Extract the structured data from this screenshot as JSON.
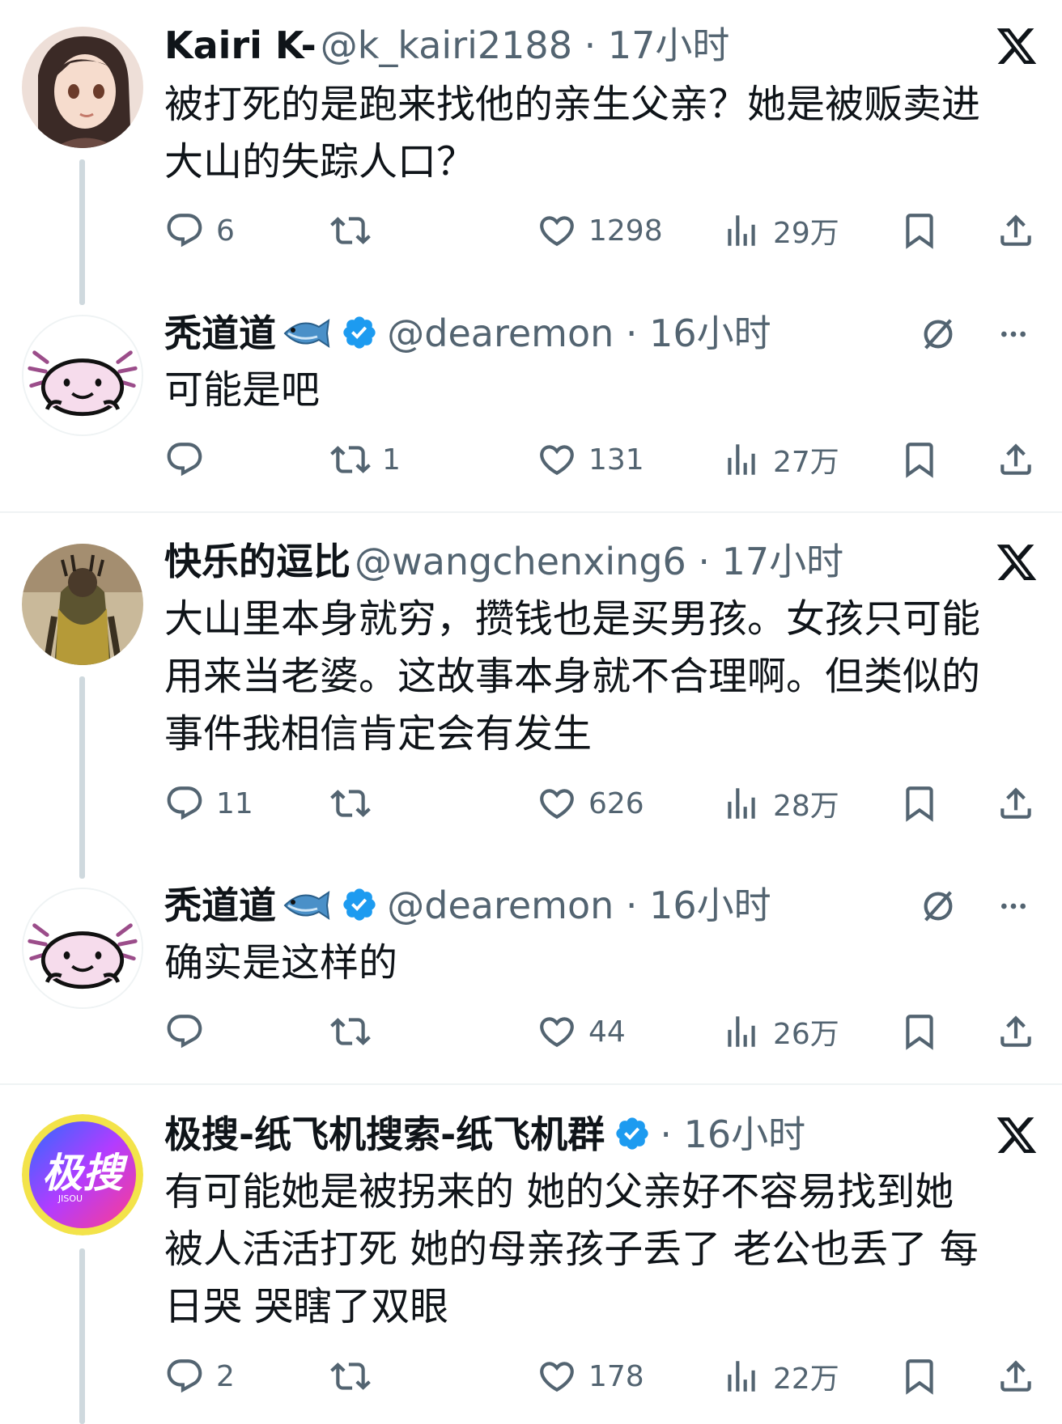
{
  "tweets": [
    {
      "name": "Kairi K-",
      "meta": "@k_kairi2188 · 17小时",
      "text": [
        "被打死的是跑来找他的亲生父亲？她是被贩卖进",
        "大山的失踪人口？"
      ],
      "reply": "6",
      "retweet": "",
      "like": "1298",
      "views": "29万",
      "corner": "x-logo"
    },
    {
      "name": "秃道道",
      "meta": "@dearemon · 16小时",
      "text": [
        "可能是吧"
      ],
      "reply": "",
      "retweet": "1",
      "like": "131",
      "views": "27万",
      "corner": "grok-and-more"
    },
    {
      "name": "快乐的逗比",
      "meta": "@wangchenxing6 · 17小时",
      "text": [
        "大山里本身就穷，攒钱也是买男孩。女孩只可能",
        "用来当老婆。这故事本身就不合理啊。但类似的",
        "事件我相信肯定会有发生"
      ],
      "reply": "11",
      "retweet": "",
      "like": "626",
      "views": "28万",
      "corner": "x-logo"
    },
    {
      "name": "秃道道",
      "meta": "@dearemon · 16小时",
      "text": [
        "确实是这样的"
      ],
      "reply": "",
      "retweet": "",
      "like": "44",
      "views": "26万",
      "corner": "grok-and-more"
    },
    {
      "name": "极搜-纸飞机搜索-纸飞机群",
      "meta": "· 16小时",
      "text": [
        "有可能她是被拐来的 她的父亲好不容易找到她",
        "被人活活打死 她的母亲孩子丢了 老公也丢了 每",
        "日哭 哭瞎了双眼"
      ],
      "reply": "2",
      "retweet": "",
      "like": "178",
      "views": "22万",
      "corner": "x-logo",
      "avatar_text": "极搜",
      "avatar_subtext": "JISOU"
    }
  ],
  "colors": {
    "verified": "#1d9bf0",
    "secondary": "#536471",
    "line": "#cfd9de"
  }
}
